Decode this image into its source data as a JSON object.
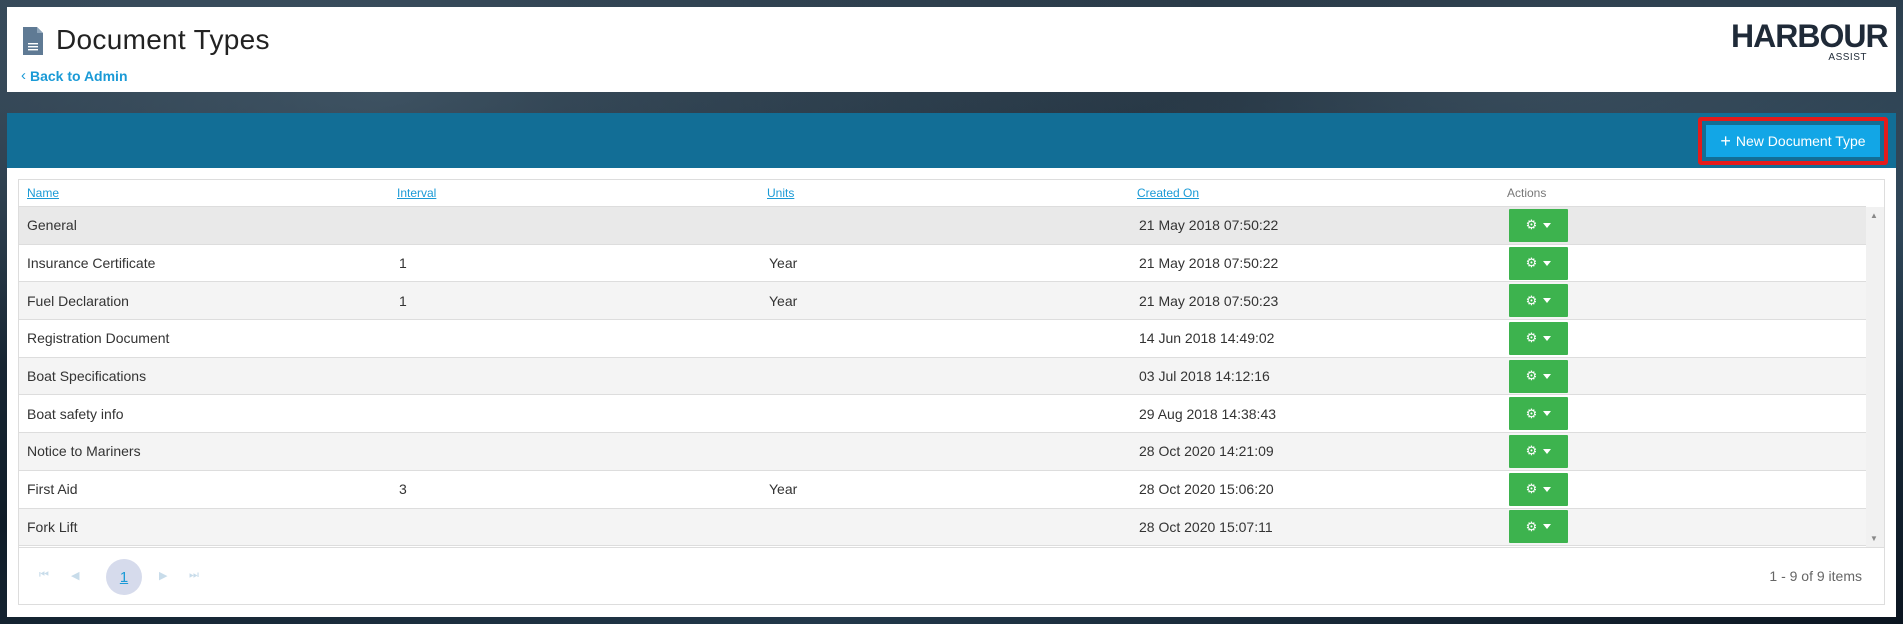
{
  "header": {
    "title": "Document Types",
    "back_label": "Back to Admin",
    "logo_main": "HARBOUR",
    "logo_sub": "ASSIST"
  },
  "toolbar": {
    "new_label": "New Document Type"
  },
  "grid": {
    "columns": [
      "Name",
      "Interval",
      "Units",
      "Created On",
      "Actions"
    ],
    "rows": [
      {
        "name": "General",
        "interval": "",
        "units": "",
        "created": "21 May 2018 07:50:22"
      },
      {
        "name": "Insurance Certificate",
        "interval": "1",
        "units": "Year",
        "created": "21 May 2018 07:50:22"
      },
      {
        "name": "Fuel Declaration",
        "interval": "1",
        "units": "Year",
        "created": "21 May 2018 07:50:23"
      },
      {
        "name": "Registration Document",
        "interval": "",
        "units": "",
        "created": "14 Jun 2018 14:49:02"
      },
      {
        "name": "Boat Specifications",
        "interval": "",
        "units": "",
        "created": "03 Jul 2018 14:12:16"
      },
      {
        "name": "Boat safety info",
        "interval": "",
        "units": "",
        "created": "29 Aug 2018 14:38:43"
      },
      {
        "name": "Notice to Mariners",
        "interval": "",
        "units": "",
        "created": "28 Oct 2020 14:21:09"
      },
      {
        "name": "First Aid",
        "interval": "3",
        "units": "Year",
        "created": "28 Oct 2020 15:06:20"
      },
      {
        "name": "Fork Lift",
        "interval": "",
        "units": "",
        "created": "28 Oct 2020 15:07:11"
      }
    ]
  },
  "pager": {
    "current_page": "1",
    "info": "1 - 9 of 9 items"
  },
  "colors": {
    "toolbar": "#126e96",
    "new_button": "#12a6e6",
    "highlight_border": "#e41b1b",
    "action_button": "#3db34e",
    "link": "#1a9ad6"
  }
}
